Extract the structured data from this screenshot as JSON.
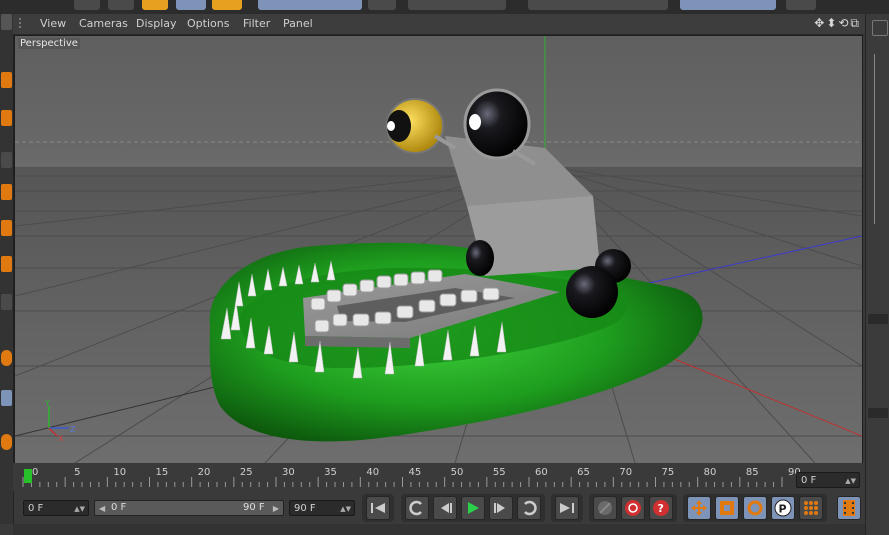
{
  "menu": {
    "items": [
      "View",
      "Cameras",
      "Display",
      "Options",
      "Filter",
      "Panel"
    ],
    "nav_icons": "✥⬍⟲⧉"
  },
  "viewport": {
    "label": "Perspective",
    "axis_x": "X",
    "axis_y": "Y",
    "axis_z": "Z"
  },
  "timeline": {
    "ticks": [
      "0",
      "5",
      "10",
      "15",
      "20",
      "25",
      "30",
      "35",
      "40",
      "45",
      "50",
      "55",
      "60",
      "65",
      "70",
      "75",
      "80",
      "85",
      "90"
    ],
    "current_frame_display": "0 F"
  },
  "transport": {
    "start_frame": "0 F",
    "range_start": "0 F",
    "range_end": "90 F",
    "end_frame": "90 F"
  },
  "colors": {
    "accent_green": "#27c12a",
    "play_green": "#2bd04a",
    "record_red": "#d03030",
    "highlight_blue": "#7d93b8",
    "orange": "#e07a10"
  }
}
